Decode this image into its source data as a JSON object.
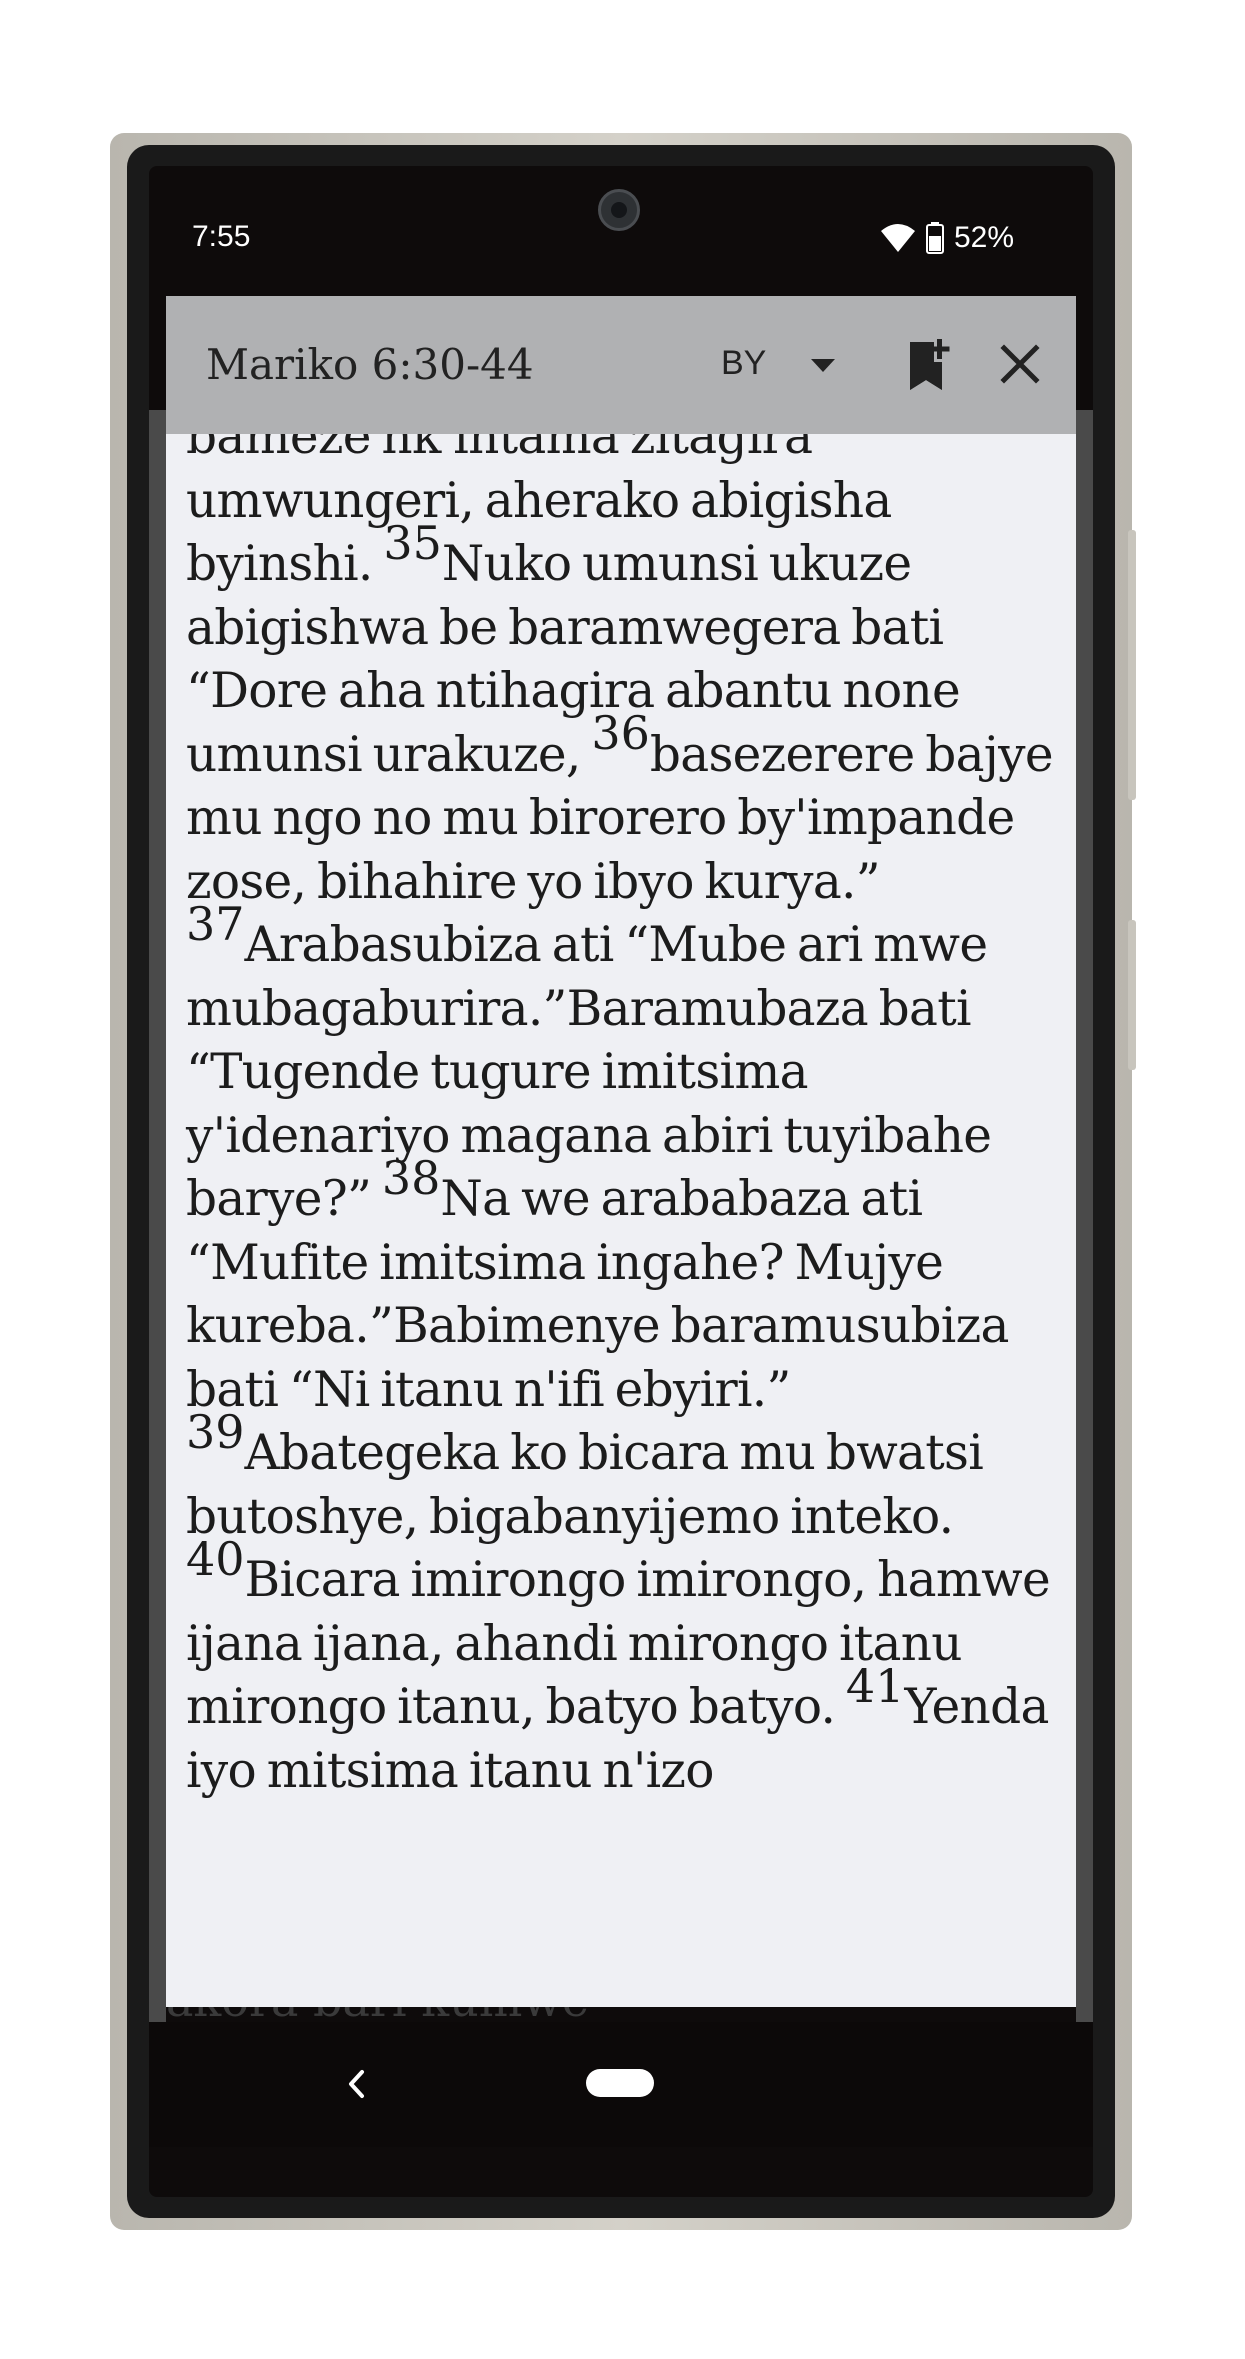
{
  "status_bar": {
    "time": "7:55",
    "battery": "52%",
    "icons": [
      "wifi-icon",
      "battery-icon"
    ]
  },
  "header": {
    "title": "Mariko 6:30-44",
    "language": "BY",
    "icons": [
      "chevron-down-icon",
      "bookmark-add-icon",
      "close-icon"
    ]
  },
  "passage": {
    "p1": "bameze nk'intama zitagira umwungeri, aherako abigisha byinshi. ",
    "v35": "35",
    "t35": "Nuko umunsi ukuze abigishwa be baramwegera bati “Dore aha ntihagira abantu none umunsi urakuze, ",
    "v36": "36",
    "t36": "basezerere bajye mu ngo no mu birorero by'impande zose, bihahire yo ibyo kurya.” ",
    "v37": "37",
    "t37": "Arabasubiza ati “Mube ari mwe mubagaburira.”Baramubaza bati “Tugende tugure imitsima y'idenariyo magana abiri tuyibahe barye?” ",
    "v38": "38",
    "t38": "Na we arababaza ati “Mufite imitsima ingahe? Mujye kureba.”Babimenye baramusubiza bati “Ni itanu n'ifi ebyiri.” ",
    "v39": "39",
    "t39": "Abategeka ko bicara mu bwatsi butoshye, bigabanyijemo inteko. ",
    "v40": "40",
    "t40": "Bicara imirongo imirongo, hamwe ijana ijana, ahandi mirongo itanu mirongo itanu, batyo batyo. ",
    "v41": "41",
    "t41": "Yenda iyo mitsima itanu n'izo"
  },
  "background_text": "akora bari kumwe",
  "nav_bar": {
    "icons": [
      "back-icon",
      "home-pill"
    ]
  },
  "colors": {
    "header_bg": "#b0b1b3",
    "body_bg": "#eff0f4",
    "text": "#1c1c1c"
  }
}
